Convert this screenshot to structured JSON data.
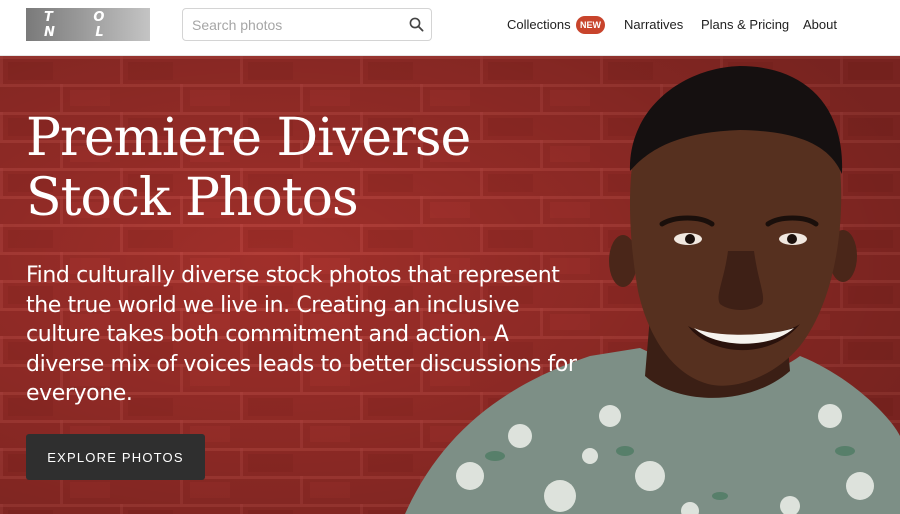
{
  "brand": {
    "logo_text": "T O N L"
  },
  "search": {
    "placeholder": "Search photos",
    "value": ""
  },
  "nav": {
    "collections": "Collections",
    "collections_badge": "NEW",
    "narratives": "Narratives",
    "plans_pricing": "Plans & Pricing",
    "about": "About"
  },
  "hero": {
    "title_line1": "Premiere Diverse",
    "title_line2": "Stock Photos",
    "description": "Find culturally diverse stock photos that represent the true world we live in. Creating an inclusive culture takes both commitment and action. A diverse mix of voices leads to better discussions for everyone.",
    "cta_label": "EXPLORE PHOTOS"
  },
  "colors": {
    "brick_red": "#9b2b26",
    "badge": "#c8442c",
    "button": "#2f2f2f"
  }
}
